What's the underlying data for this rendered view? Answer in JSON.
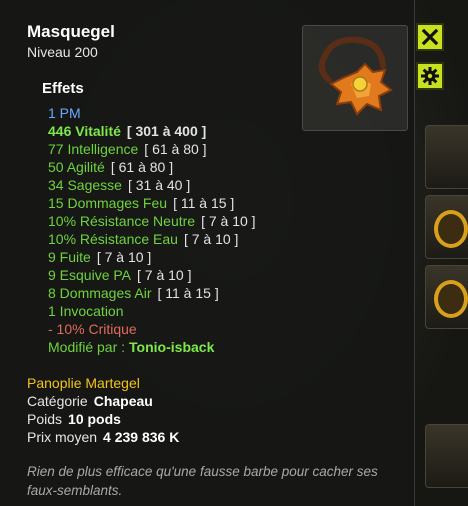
{
  "item": {
    "name": "Masquegel",
    "level": "Niveau  200",
    "image": "masquegel-mask-icon"
  },
  "effects_title": "Effets",
  "effects": [
    {
      "text": "1 PM",
      "range": "",
      "style": "blue"
    },
    {
      "text": "446 Vitalité",
      "range": "[ 301 à 400 ]",
      "style": "big"
    },
    {
      "text": "77 Intelligence",
      "range": "[ 61 à 80 ]",
      "style": ""
    },
    {
      "text": "50 Agilité",
      "range": "[ 61 à 80 ]",
      "style": ""
    },
    {
      "text": "34 Sagesse",
      "range": "[ 31 à 40 ]",
      "style": ""
    },
    {
      "text": "15 Dommages Feu",
      "range": "[ 11 à 15 ]",
      "style": ""
    },
    {
      "text": "10% Résistance Neutre",
      "range": "[ 7 à 10 ]",
      "style": ""
    },
    {
      "text": "10% Résistance Eau",
      "range": "[ 7 à 10 ]",
      "style": ""
    },
    {
      "text": "9 Fuite",
      "range": "[ 7 à 10 ]",
      "style": ""
    },
    {
      "text": "9 Esquive PA",
      "range": "[ 7 à 10 ]",
      "style": ""
    },
    {
      "text": "8 Dommages Air",
      "range": "[ 11 à 15 ]",
      "style": ""
    },
    {
      "text": "1 Invocation",
      "range": "",
      "style": ""
    },
    {
      "text": "- 10% Critique",
      "range": "",
      "style": "neg"
    }
  ],
  "modified_by": {
    "label": "Modifié par :",
    "name": "Tonio-isback"
  },
  "panoplie": "Panoplie Martegel",
  "category": {
    "label": "Catégorie",
    "value": "Chapeau"
  },
  "weight": {
    "label": "Poids",
    "value": "10 pods"
  },
  "price": {
    "label": "Prix moyen",
    "value": "4 239 836 K"
  },
  "description": "Rien de plus efficace qu'une fausse barbe pour cacher ses faux-semblants.",
  "buttons": {
    "close": "close-icon",
    "settings": "gear-icon"
  },
  "colors": {
    "effect_green": "#6fd23e",
    "pm_blue": "#6aa9ff",
    "negative": "#e06a5a",
    "set_gold": "#f0c419",
    "button_lime": "#c7e120"
  }
}
